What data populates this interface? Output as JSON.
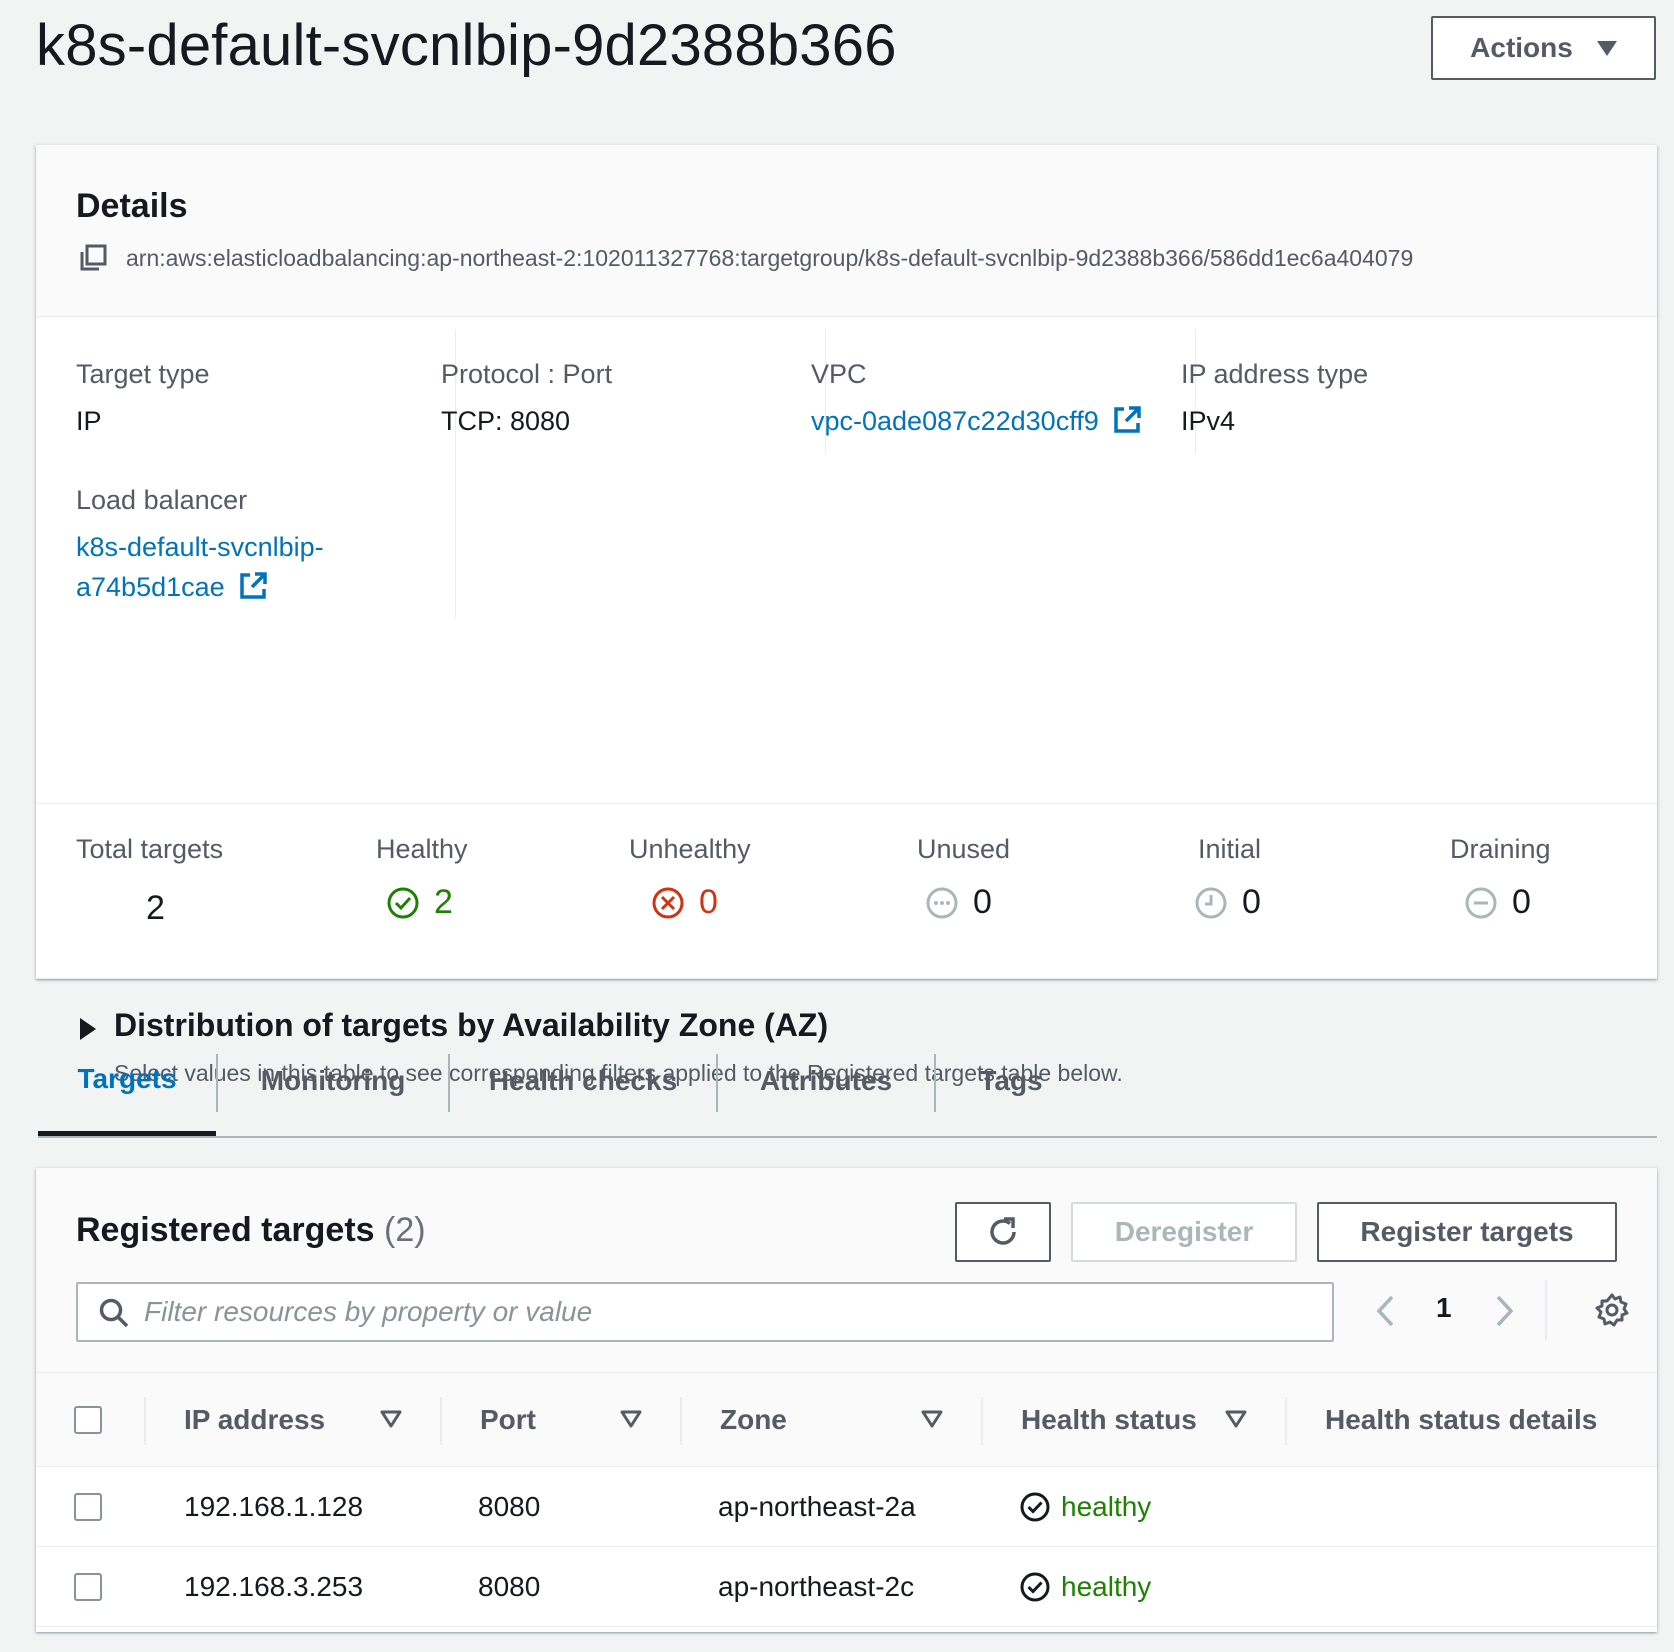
{
  "page": {
    "title": "k8s-default-svcnlbip-9d2388b366",
    "actions_label": "Actions"
  },
  "details": {
    "heading": "Details",
    "arn": "arn:aws:elasticloadbalancing:ap-northeast-2:102011327768:targetgroup/k8s-default-svcnlbip-9d2388b366/586dd1ec6a404079",
    "target_type_label": "Target type",
    "target_type_value": "IP",
    "load_balancer_label": "Load balancer",
    "load_balancer_line1": "k8s-default-svcnlbip-",
    "load_balancer_line2": "a74b5d1cae",
    "protocol_port_label": "Protocol : Port",
    "protocol_port_value": "TCP: 8080",
    "vpc_label": "VPC",
    "vpc_value": "vpc-0ade087c22d30cff9",
    "ip_address_type_label": "IP address type",
    "ip_address_type_value": "IPv4"
  },
  "counts": {
    "total_label": "Total targets",
    "total_value": "2",
    "healthy_label": "Healthy",
    "healthy_value": "2",
    "unhealthy_label": "Unhealthy",
    "unhealthy_value": "0",
    "unused_label": "Unused",
    "unused_value": "0",
    "initial_label": "Initial",
    "initial_value": "0",
    "draining_label": "Draining",
    "draining_value": "0"
  },
  "az": {
    "title": "Distribution of targets by Availability Zone (AZ)",
    "description": "Select values in this table to see corresponding filters applied to the Registered targets table below."
  },
  "tabs": [
    {
      "label": "Targets",
      "active": true
    },
    {
      "label": "Monitoring",
      "active": false
    },
    {
      "label": "Health checks",
      "active": false
    },
    {
      "label": "Attributes",
      "active": false
    },
    {
      "label": "Tags",
      "active": false
    }
  ],
  "registered": {
    "title": "Registered targets",
    "count": "(2)",
    "deregister_label": "Deregister",
    "register_label": "Register targets",
    "search_placeholder": "Filter resources by property or value",
    "page": "1",
    "columns": [
      "IP address",
      "Port",
      "Zone",
      "Health status",
      "Health status details"
    ],
    "rows": [
      {
        "ip": "192.168.1.128",
        "port": "8080",
        "zone": "ap-northeast-2a",
        "health": "healthy",
        "details": ""
      },
      {
        "ip": "192.168.3.253",
        "port": "8080",
        "zone": "ap-northeast-2c",
        "health": "healthy",
        "details": ""
      }
    ]
  },
  "colors": {
    "link": "#0073bb",
    "healthy": "#1d8102",
    "unhealthy": "#d13212",
    "neutral": "#aab7b8"
  },
  "icons": [
    "copy-icon",
    "external-link-icon",
    "check-circle-icon",
    "x-circle-icon",
    "ellipsis-circle-icon",
    "clock-icon",
    "minus-circle-icon",
    "refresh-icon",
    "search-icon",
    "chevron-left-icon",
    "chevron-right-icon",
    "gear-icon",
    "sort-down-icon",
    "caret-right-icon",
    "caret-down-icon"
  ]
}
